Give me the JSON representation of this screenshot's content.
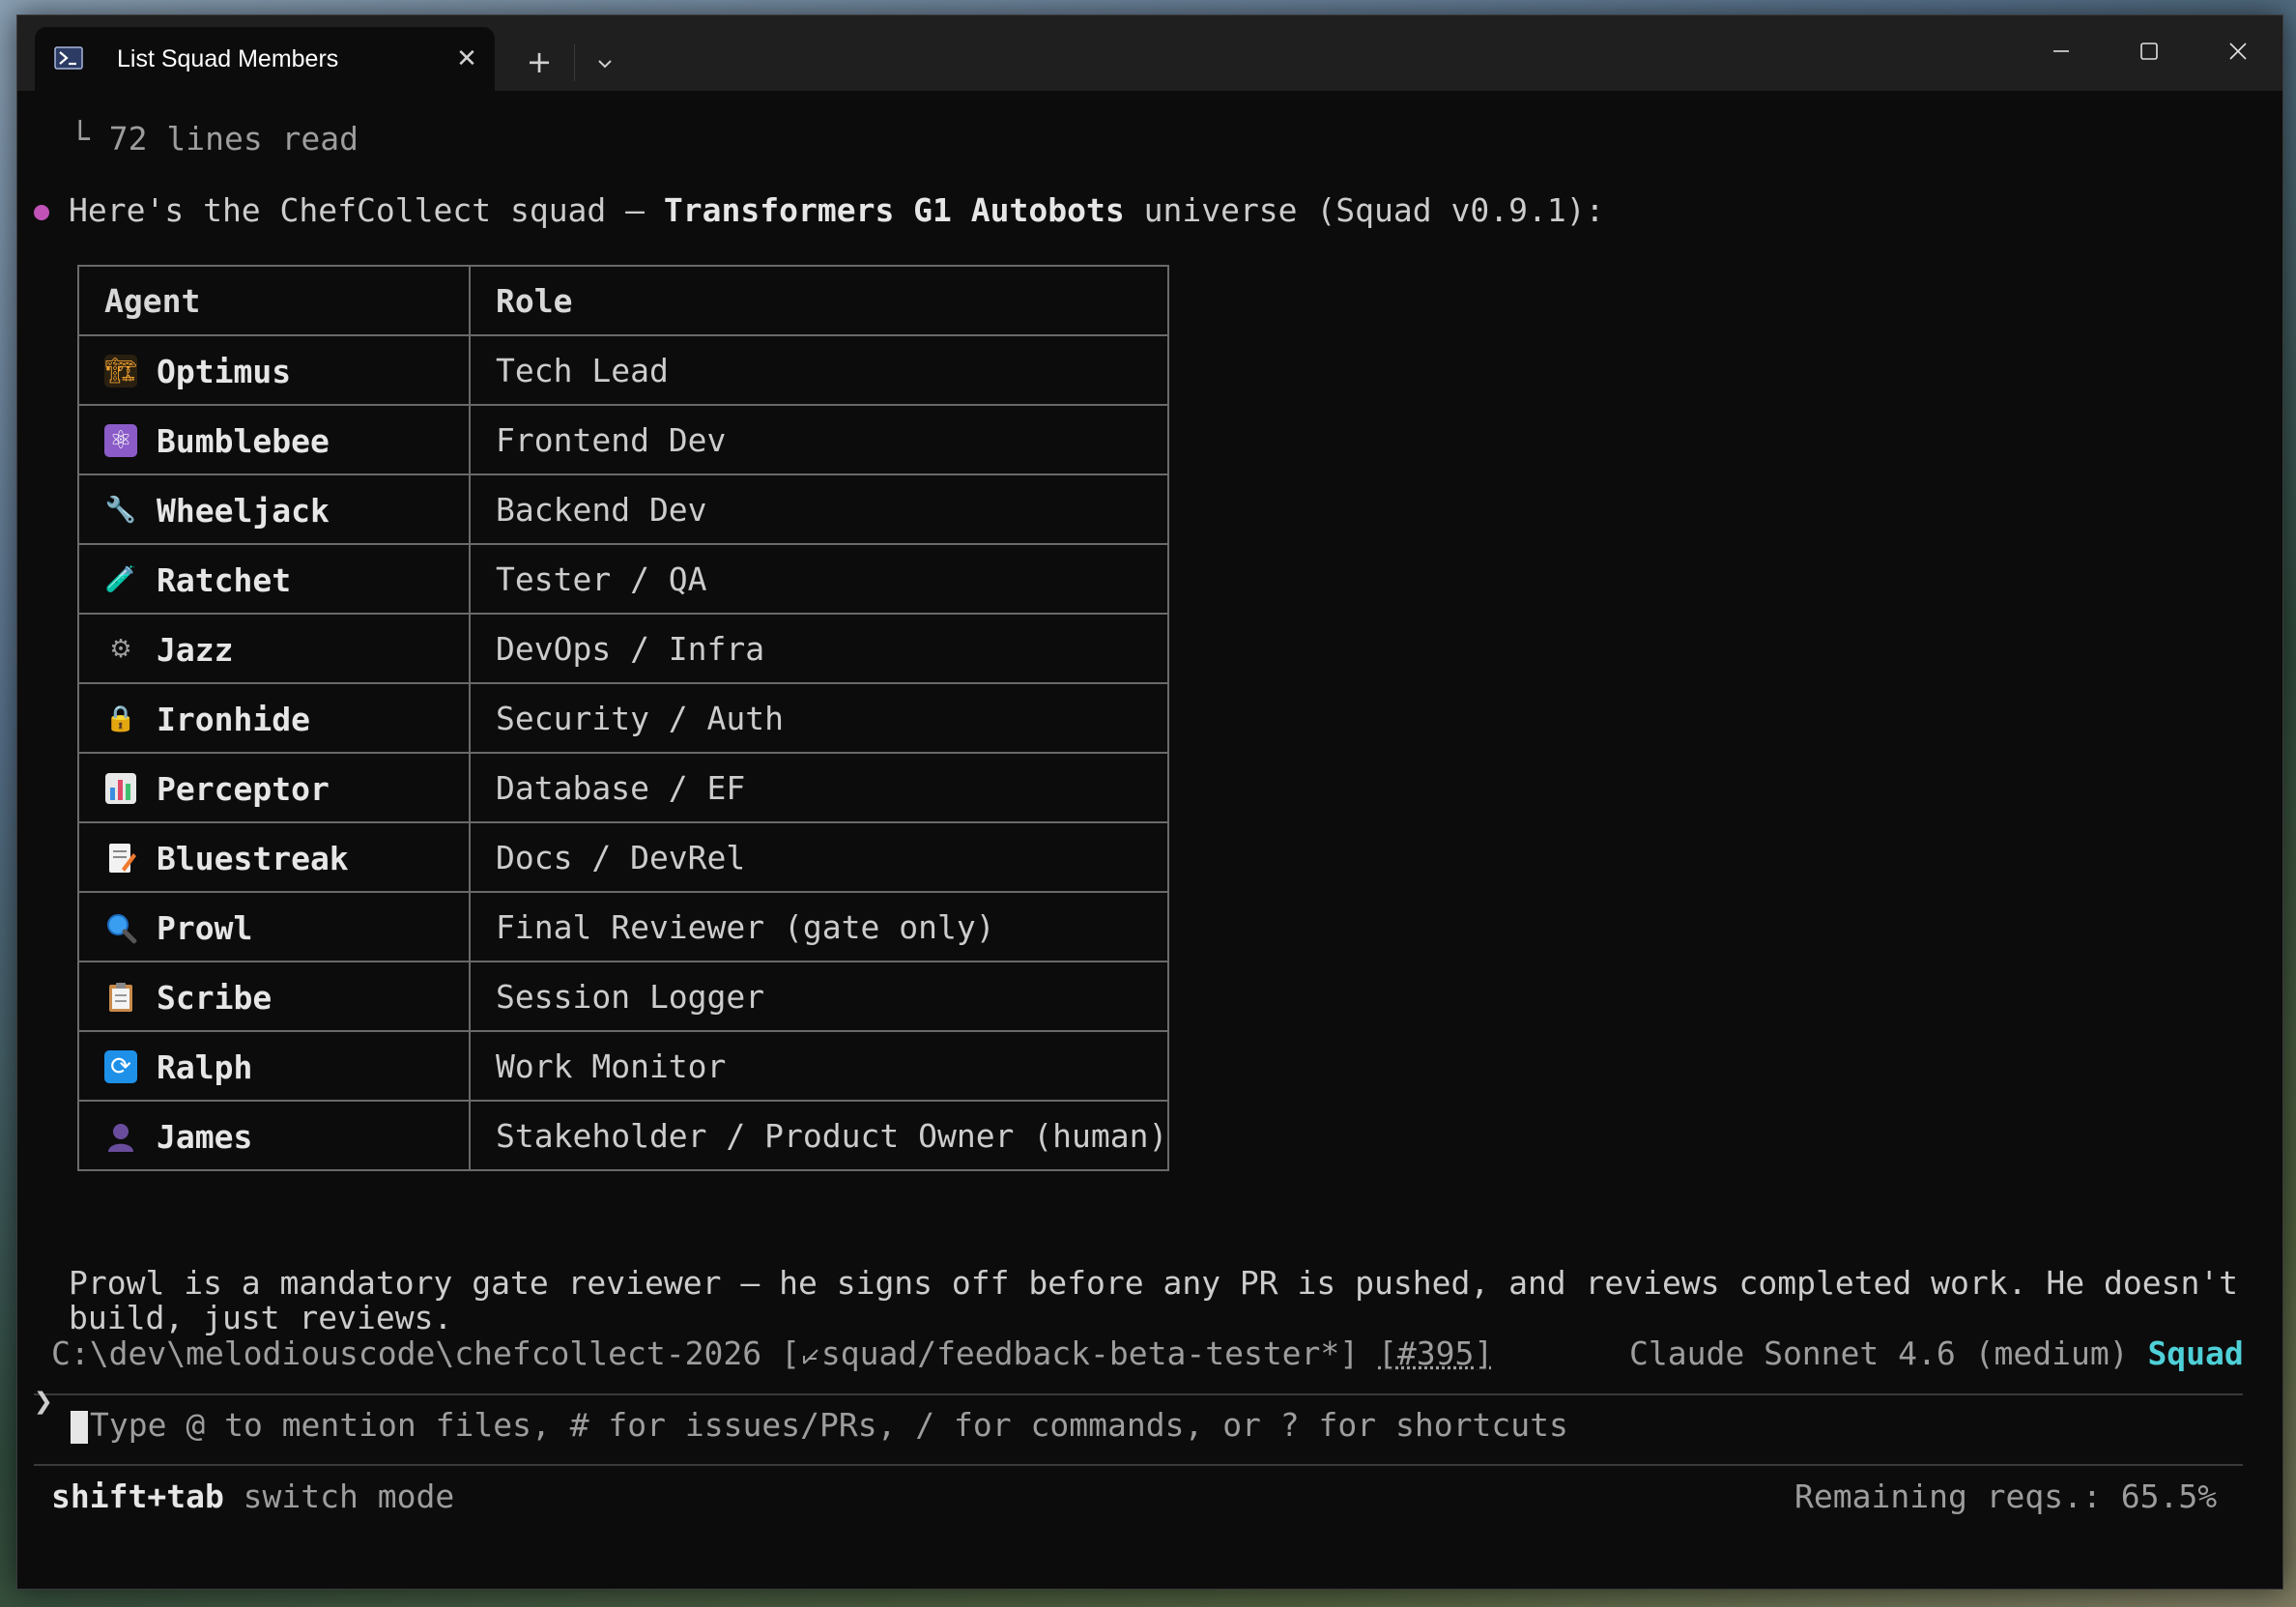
{
  "window": {
    "tab_title": "List Squad Members",
    "tab_icon": "powershell-icon"
  },
  "output": {
    "lines_read": "72 lines read",
    "intro_pre": "Here's the ChefCollect squad — ",
    "intro_bold": "Transformers G1 Autobots",
    "intro_post": " universe (Squad v0.9.1):",
    "note_line1": "Prowl is a mandatory gate reviewer — he signs off before any PR is pushed, and reviews completed work. He doesn't",
    "note_line2": "build, just reviews."
  },
  "table": {
    "headers": [
      "Agent",
      "Role"
    ],
    "rows": [
      {
        "agent": "Optimus",
        "role": "Tech Lead",
        "icon": "construction-crane-icon"
      },
      {
        "agent": "Bumblebee",
        "role": "Frontend Dev",
        "icon": "atom-icon"
      },
      {
        "agent": "Wheeljack",
        "role": "Backend Dev",
        "icon": "wrench-icon"
      },
      {
        "agent": "Ratchet",
        "role": "Tester / QA",
        "icon": "test-tube-icon"
      },
      {
        "agent": "Jazz",
        "role": "DevOps / Infra",
        "icon": "gear-icon"
      },
      {
        "agent": "Ironhide",
        "role": "Security / Auth",
        "icon": "lock-icon"
      },
      {
        "agent": "Perceptor",
        "role": "Database / EF",
        "icon": "bar-chart-icon"
      },
      {
        "agent": "Bluestreak",
        "role": "Docs / DevRel",
        "icon": "memo-icon"
      },
      {
        "agent": "Prowl",
        "role": "Final Reviewer (gate only)",
        "icon": "magnifier-icon"
      },
      {
        "agent": "Scribe",
        "role": "Session Logger",
        "icon": "clipboard-icon"
      },
      {
        "agent": "Ralph",
        "role": "Work Monitor",
        "icon": "refresh-icon"
      },
      {
        "agent": "James",
        "role": "Stakeholder / Product Owner (human)",
        "icon": "person-silhouette-icon"
      }
    ]
  },
  "status": {
    "path": "C:\\dev\\melodiouscode\\chefcollect-2026",
    "branch_open": " [",
    "branch_icon": "branch-icon",
    "branch": "squad/feedback-beta-tester*",
    "branch_close": "] ",
    "issue": "[#395]",
    "model": "Claude Sonnet 4.6 (medium)",
    "agent": "Squad"
  },
  "input": {
    "prompt": "❯",
    "placeholder": "Type @ to mention files, # for issues/PRs, / for commands, or ? for shortcuts"
  },
  "footer": {
    "shortcut_key": "shift+tab",
    "shortcut_desc": " switch mode",
    "remaining": "Remaining reqs.: 65.5%"
  },
  "colors": {
    "terminal_bg": "#0c0c0c",
    "titlebar_bg": "#1f1f1f",
    "bullet": "#c052b8",
    "agent_accent": "#4fd0d8"
  }
}
